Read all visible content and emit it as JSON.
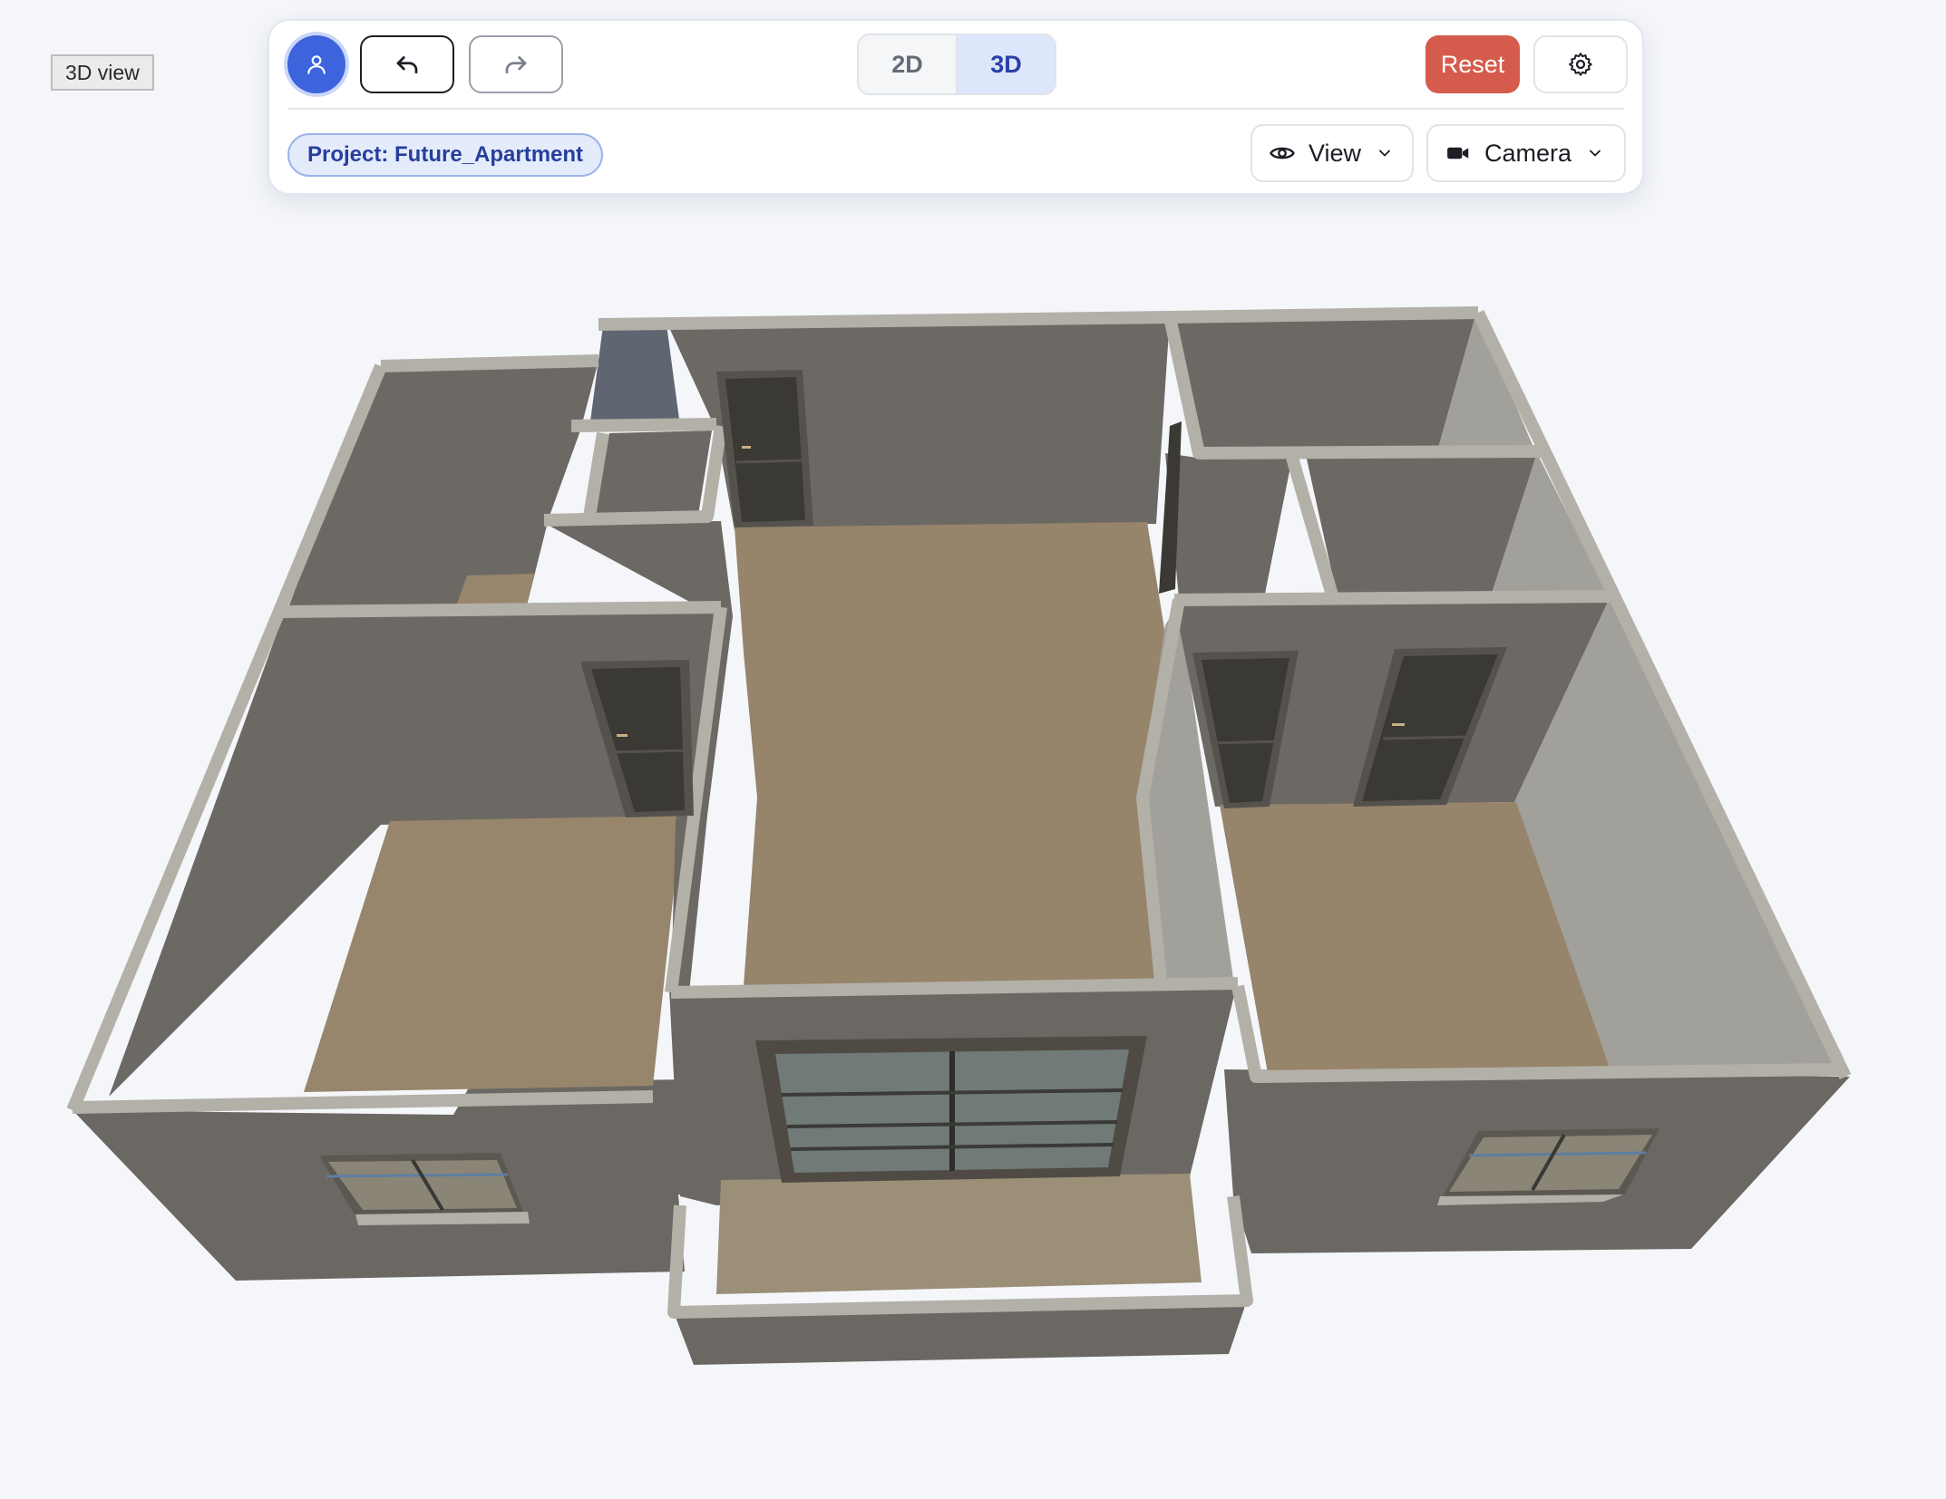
{
  "viewport_label": "3D view",
  "toolbar": {
    "avatar_icon": "user-icon",
    "undo_icon": "undo-arrow-icon",
    "redo_icon": "redo-arrow-icon",
    "mode_toggle": {
      "options": [
        "2D",
        "3D"
      ],
      "selected": "3D"
    },
    "reset_label": "Reset",
    "settings_icon": "gear-icon",
    "project_label": "Project: Future_Apartment",
    "view_dropdown": {
      "label": "View",
      "icon": "eye-icon"
    },
    "camera_dropdown": {
      "label": "Camera",
      "icon": "video-camera-icon"
    }
  },
  "colors": {
    "accent": "#3d63dd",
    "reset": "#d55b4c",
    "selected_mode_bg": "#dde6fb",
    "floor": "#96846b",
    "wall": "#6c6964"
  }
}
